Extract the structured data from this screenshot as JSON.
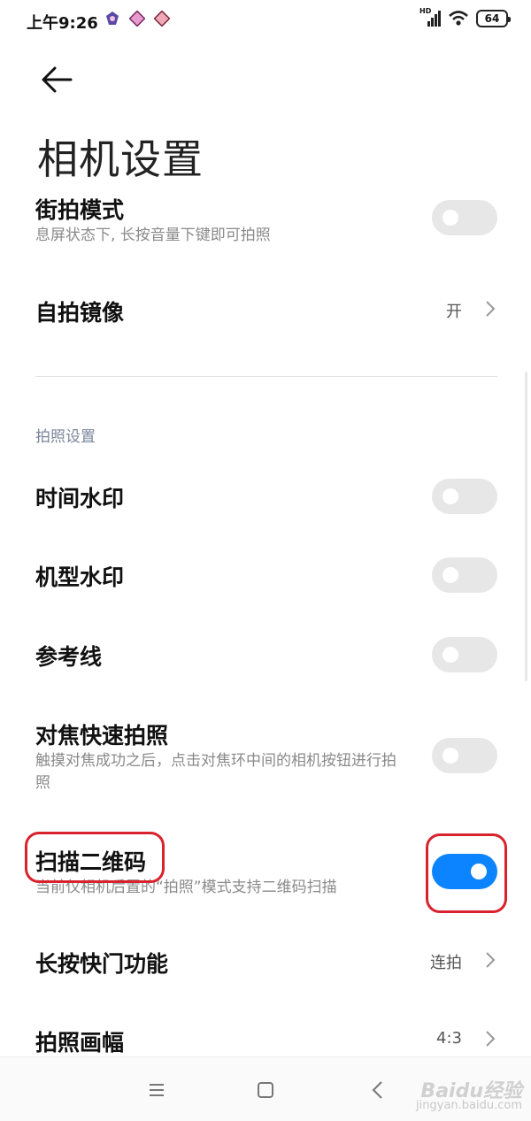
{
  "status_bar": {
    "time": "上午9:26",
    "network": "HD",
    "battery": "64",
    "notification_icons": [
      "app-icon",
      "app-icon",
      "app-icon"
    ]
  },
  "header": {
    "title": "相机设置"
  },
  "settings": {
    "street_mode": {
      "title": "街拍模式",
      "desc": "息屏状态下, 长按音量下键即可拍照",
      "toggle_on": false
    },
    "selfie_mirror": {
      "title": "自拍镜像",
      "value": "开"
    },
    "section_title": "拍照设置",
    "time_watermark": {
      "title": "时间水印",
      "toggle_on": false
    },
    "model_watermark": {
      "title": "机型水印",
      "toggle_on": false
    },
    "grid_lines": {
      "title": "参考线",
      "toggle_on": false
    },
    "focus_shoot": {
      "title": "对焦快速拍照",
      "desc": "触摸对焦成功之后，点击对焦环中间的相机按钮进行拍照",
      "toggle_on": false
    },
    "scan_qr": {
      "title": "扫描二维码",
      "desc": "当前仅相机后置的“拍照”模式支持二维码扫描",
      "toggle_on": true
    },
    "long_press_shutter": {
      "title": "长按快门功能",
      "value": "连拍"
    },
    "aspect_ratio": {
      "title": "拍照画幅",
      "value": "4:3"
    }
  },
  "colors": {
    "accent": "#0d84ff",
    "annotation": "#d8222c",
    "toggle_off": "#e7e7e7"
  },
  "watermark": {
    "brand": "Baidu经验",
    "url": "jingyan.baidu.com"
  }
}
